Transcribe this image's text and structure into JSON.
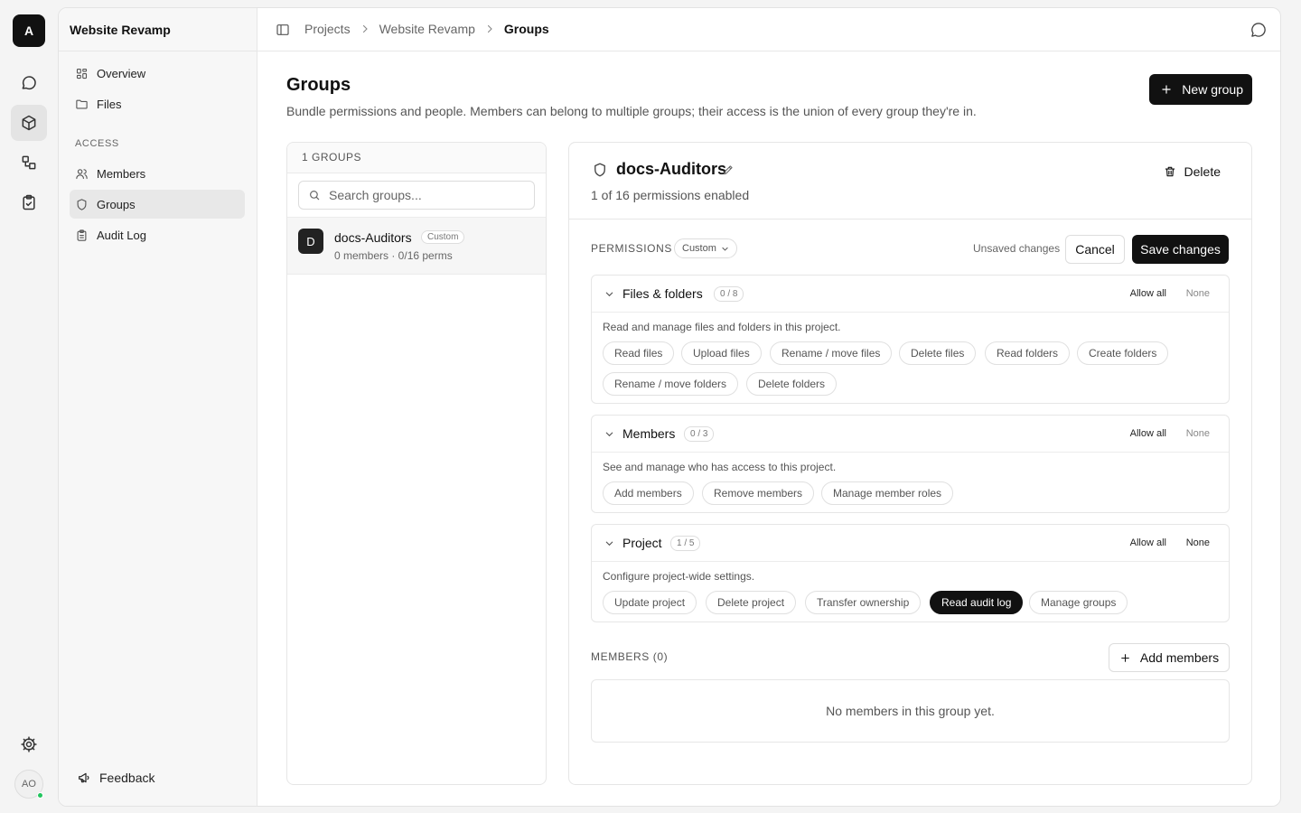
{
  "rail": {
    "logo_letter": "A",
    "items": [
      "chat-icon",
      "box-icon",
      "workflow-icon",
      "clipboard-check-icon"
    ],
    "avatar_initials": "AO"
  },
  "sidebar": {
    "project_title": "Website Revamp",
    "items": [
      {
        "label": "Overview",
        "icon": "grid-icon"
      },
      {
        "label": "Files",
        "icon": "folder-icon"
      }
    ],
    "access_section": "ACCESS",
    "access_items": [
      {
        "label": "Members",
        "icon": "users-icon"
      },
      {
        "label": "Groups",
        "icon": "shield-icon",
        "active": true
      },
      {
        "label": "Audit Log",
        "icon": "clipboard-icon"
      }
    ],
    "feedback_label": "Feedback"
  },
  "header": {
    "breadcrumb": [
      "Projects",
      "Website Revamp",
      "Groups"
    ]
  },
  "page": {
    "title": "Groups",
    "subtitle": "Bundle permissions and people. Members can belong to multiple groups; their access is the union of every group they're in.",
    "new_group_label": "New group"
  },
  "group_list": {
    "header": "1 GROUPS",
    "search_placeholder": "Search groups...",
    "groups": [
      {
        "initial": "D",
        "name": "docs-Auditors",
        "badge": "Custom",
        "meta": "0 members · 0/16 perms"
      }
    ]
  },
  "detail": {
    "name": "docs-Auditors",
    "summary": "1 of 16 permissions enabled",
    "delete_label": "Delete",
    "permissions_label": "PERMISSIONS",
    "mode_label": "Custom",
    "unsaved_label": "Unsaved changes",
    "cancel_label": "Cancel",
    "save_label": "Save changes",
    "allow_all_label": "Allow all",
    "none_label": "None",
    "sections": [
      {
        "name": "Files & folders",
        "count": "0 / 8",
        "description": "Read and manage files and folders in this project.",
        "permissions": [
          {
            "label": "Read files",
            "enabled": false
          },
          {
            "label": "Upload files",
            "enabled": false
          },
          {
            "label": "Rename / move files",
            "enabled": false
          },
          {
            "label": "Delete files",
            "enabled": false
          },
          {
            "label": "Read folders",
            "enabled": false
          },
          {
            "label": "Create folders",
            "enabled": false
          },
          {
            "label": "Rename / move folders",
            "enabled": false
          },
          {
            "label": "Delete folders",
            "enabled": false
          }
        ]
      },
      {
        "name": "Members",
        "count": "0 / 3",
        "description": "See and manage who has access to this project.",
        "permissions": [
          {
            "label": "Add members",
            "enabled": false
          },
          {
            "label": "Remove members",
            "enabled": false
          },
          {
            "label": "Manage member roles",
            "enabled": false
          }
        ]
      },
      {
        "name": "Project",
        "count": "1 / 5",
        "description": "Configure project-wide settings.",
        "permissions": [
          {
            "label": "Update project",
            "enabled": false
          },
          {
            "label": "Delete project",
            "enabled": false
          },
          {
            "label": "Transfer ownership",
            "enabled": false
          },
          {
            "label": "Read audit log",
            "enabled": true
          },
          {
            "label": "Manage groups",
            "enabled": false
          }
        ]
      }
    ],
    "members_label": "MEMBERS (0)",
    "add_members_label": "Add members",
    "empty_members": "No members in this group yet."
  },
  "colors": {
    "accent": "#111111",
    "online": "#22c55e"
  }
}
